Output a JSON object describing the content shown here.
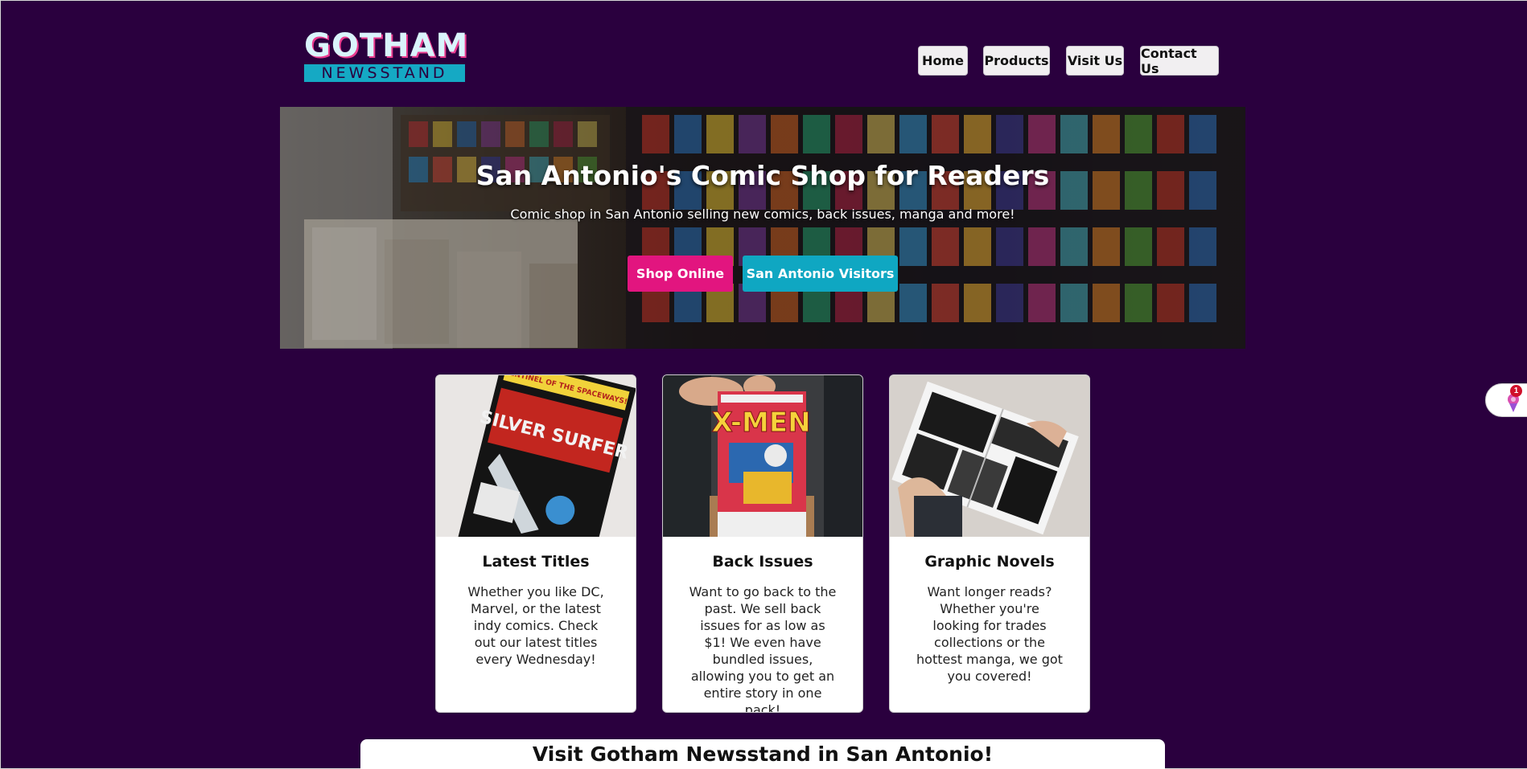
{
  "header": {
    "logo_top": "GOTHAM",
    "logo_bottom": "NEWSSTAND",
    "nav": [
      {
        "label": "Home"
      },
      {
        "label": "Products"
      },
      {
        "label": "Visit Us"
      },
      {
        "label": "Contact Us"
      }
    ]
  },
  "hero": {
    "title": "San Antonio's Comic Shop for Readers",
    "subtitle": "Comic shop in San Antonio selling new comics, back issues, manga and more!",
    "buttons": [
      {
        "label": "Shop Online",
        "color": "#e2157f"
      },
      {
        "label": "San Antonio Visitors",
        "color": "#0fa7c2"
      }
    ]
  },
  "cards": [
    {
      "title": "Latest Titles",
      "text": "Whether you like DC, Marvel, or the latest indy comics. Check out our latest titles every Wednesday!",
      "image_text": [
        "SENTINEL OF THE SPACEWAYS!",
        "SILVER SURFER"
      ]
    },
    {
      "title": "Back Issues",
      "text": "Want to go back to the past. We sell back issues for as low as $1! We even have bundled issues, allowing you to get an entire story in one pack!",
      "image_text": [
        "X-MEN"
      ]
    },
    {
      "title": "Graphic Novels",
      "text": "Want longer reads? Whether you're looking for trades collections or the hottest manga, we got you covered!"
    }
  ],
  "visit": {
    "title": "Visit Gotham Newsstand in San Antonio!"
  },
  "widget": {
    "badge": "1",
    "icon": "ice-cream-icon"
  },
  "colors": {
    "background": "#2a003e",
    "accent_pink": "#e2157f",
    "accent_cyan": "#0fa7c2"
  }
}
